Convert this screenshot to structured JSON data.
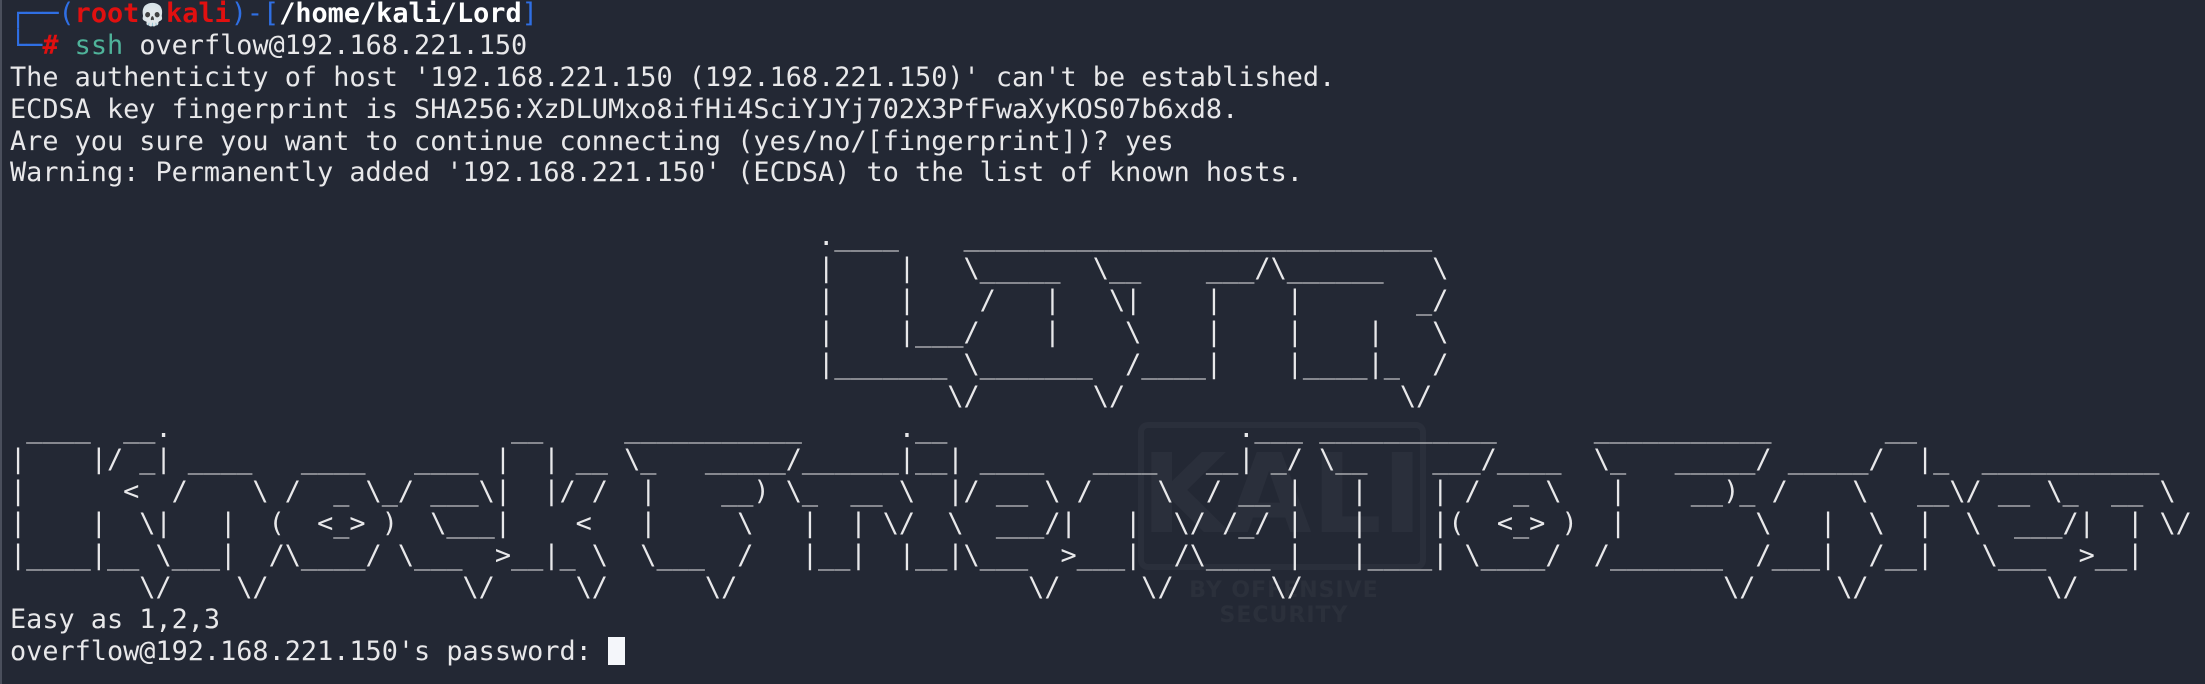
{
  "colors": {
    "background": "#232834",
    "text": "#e8e8ea",
    "prompt_frame": "#2f6fe4",
    "prompt_user": "#e01010",
    "command": "#4fb39a"
  },
  "prompt": {
    "frame_top": "┌──(",
    "user": "root",
    "skull_icon": "💀",
    "host": "kali",
    "mid": ")-[",
    "cwd": "/home/kali/Lord",
    "end": "]",
    "frame_bottom": "└─",
    "hash": "#",
    "command": "ssh",
    "args": " overflow@192.168.221.150"
  },
  "output": [
    "The authenticity of host '192.168.221.150 (192.168.221.150)' can't be established.",
    "ECDSA key fingerprint is SHA256:XzDLUMxo8ifHi4SciYJYj702X3PfFwaXyKOS07b6xd8.",
    "Are you sure you want to continue connecting (yes/no/[fingerprint])? yes",
    "Warning: Permanently added '192.168.221.150' (ECDSA) to the list of known hosts."
  ],
  "banner": {
    "lotr": [
      ".____    _____________________________",
      "|    |   \\_____  \\__    ___/\\______   \\",
      "|    |    /   |   \\|    |    |       _/",
      "|    |___/    |    \\    |    |    |   \\",
      "|_______ \\_______  /____|    |____|_  /",
      "        \\/       \\/                 \\/"
    ],
    "knock": [
      " ____  __.                     __",
      "|    |/ _| ____   ____   ____ |  | __",
      "|      <  /    \\ /  _ \\_/ ___\\|  |/ /",
      "|    |  \\|   |  (  <_> )  \\___|    <",
      "|____|__ \\___|  /\\____/ \\___  >__|_ \\",
      "        \\/    \\/            \\/     \\/"
    ],
    "friend": [
      "___________      .__                  .___",
      "\\_   _____/______|__| ____   ____   __| _/",
      " |    __) \\_  __ \\  |/ __ \\ /    \\  / __ |",
      " |     \\   |  | \\/  \\  ___/|   |  \\/ /_/ |",
      " \\___  /   |__|  |__|\\___  >___|  /\\____ |",
      "     \\/                  \\/     \\/      \\/"
    ],
    "to": [
      "___________",
      "\\__    ___/____",
      "  |    | /  _ \\",
      "  |    |(  <_> )",
      "  |____| \\____/",
      ""
    ],
    "enter": [
      "___________       __",
      "\\_   _____/ _____/  |_  ___________",
      " |    __)_ /    \\   __\\/ __ \\_  __ \\",
      " |        \\   |  \\  |  \\  ___/|  | \\/",
      "/_______  /___|  /__|   \\___  >__|",
      "        \\/     \\/           \\/"
    ]
  },
  "motd": "Easy as 1,2,3",
  "password_prompt": "overflow@192.168.221.150's password: ",
  "watermark": {
    "logo": "KALI",
    "tagline": "BY OFFENSIVE SECURITY"
  }
}
